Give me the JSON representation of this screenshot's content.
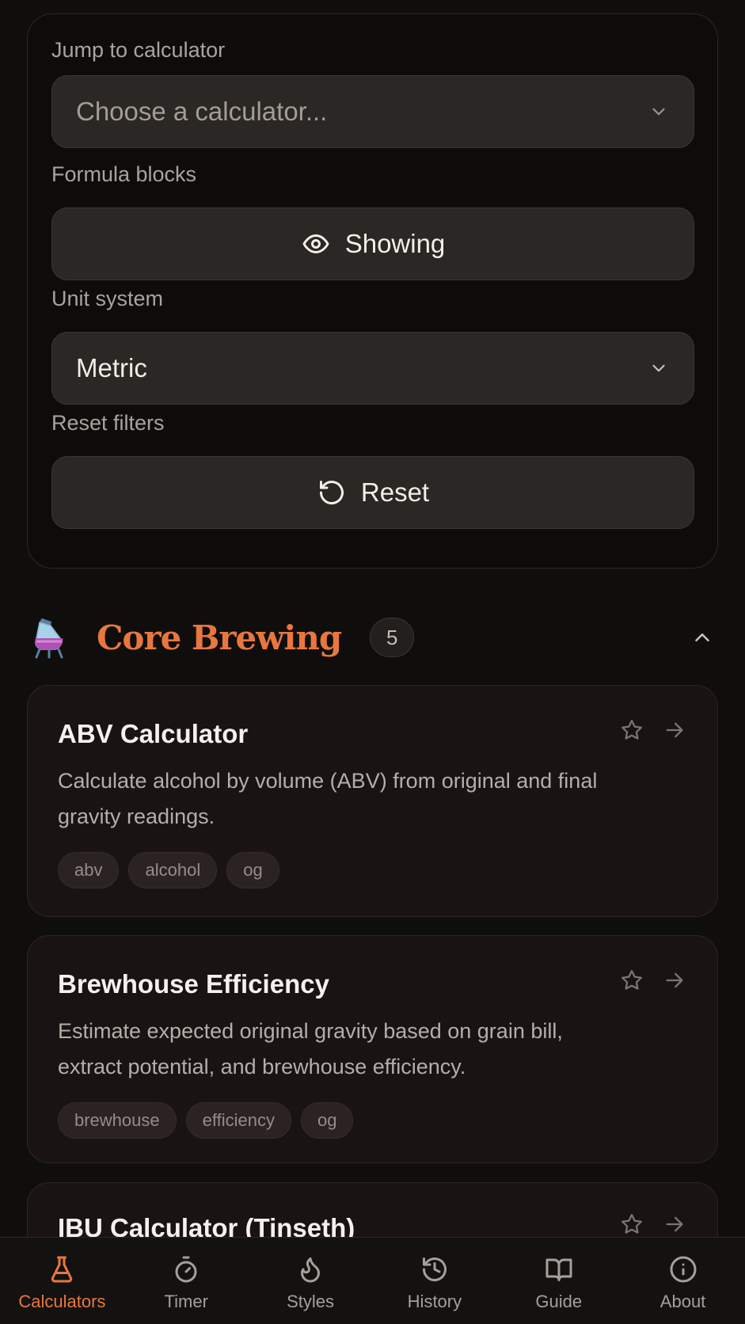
{
  "filters": {
    "jump_label": "Jump to calculator",
    "jump_placeholder": "Choose a calculator...",
    "formula_label": "Formula blocks",
    "formula_button": "Showing",
    "unit_label": "Unit system",
    "unit_value": "Metric",
    "reset_label": "Reset filters",
    "reset_button": "Reset"
  },
  "section": {
    "title": "Core Brewing",
    "count": "5",
    "icon": "flask-emoji"
  },
  "cards": [
    {
      "title": "ABV Calculator",
      "description": "Calculate alcohol by volume (ABV) from original and final gravity readings.",
      "tags": [
        "abv",
        "alcohol",
        "og"
      ]
    },
    {
      "title": "Brewhouse Efficiency",
      "description": "Estimate expected original gravity based on grain bill, extract potential, and brewhouse efficiency.",
      "tags": [
        "brewhouse",
        "efficiency",
        "og"
      ]
    },
    {
      "title": "IBU Calculator (Tinseth)"
    }
  ],
  "nav": [
    {
      "label": "Calculators",
      "icon": "flask-icon",
      "active": true
    },
    {
      "label": "Timer",
      "icon": "timer-icon"
    },
    {
      "label": "Styles",
      "icon": "flame-icon"
    },
    {
      "label": "History",
      "icon": "history-icon"
    },
    {
      "label": "Guide",
      "icon": "book-icon"
    },
    {
      "label": "About",
      "icon": "info-icon"
    }
  ],
  "colors": {
    "accent": "#e8773f",
    "background": "#100e0d",
    "card": "#1a1314"
  }
}
